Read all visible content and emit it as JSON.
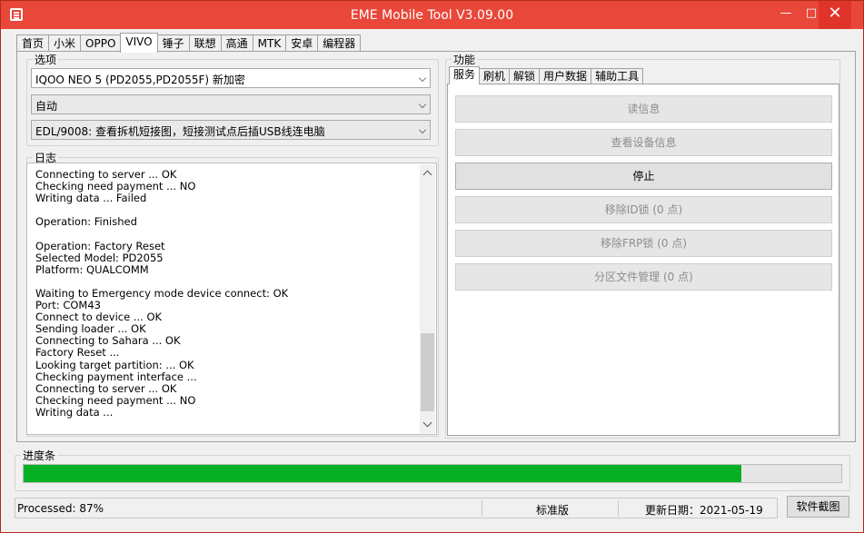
{
  "window": {
    "title": "EME Mobile Tool V3.09.00",
    "min_glyph": "—",
    "max_glyph": "□",
    "close_glyph": "✕"
  },
  "top_tabs": [
    "首页",
    "小米",
    "OPPO",
    "VIVO",
    "锤子",
    "联想",
    "高通",
    "MTK",
    "安卓",
    "编程器"
  ],
  "top_tab_active": "VIVO",
  "options": {
    "label": "选项",
    "model": "IQOO NEO 5 (PD2055,PD2055F) 新加密",
    "mode": "自动",
    "method": "EDL/9008: 查看拆机短接图，短接测试点后插USB线连电脑"
  },
  "log": {
    "label": "日志",
    "lines": [
      "Connecting to server ... OK",
      "Checking need payment ... NO",
      "Writing data ... Failed",
      "",
      "Operation: Finished",
      "",
      "Operation: Factory Reset",
      "Selected Model: PD2055",
      "Platform: QUALCOMM",
      "",
      "Waiting to Emergency mode device connect: OK",
      "Port: COM43",
      "Connect to device ... OK",
      "Sending loader ... OK",
      "Connecting to Sahara ... OK",
      "Factory Reset ...",
      "Looking target partition: ... OK",
      "Checking payment interface ...",
      "Connecting to server ... OK",
      "Checking need payment ... NO",
      "Writing data ..."
    ]
  },
  "functions": {
    "label": "功能",
    "tabs": [
      "服务",
      "刷机",
      "解锁",
      "用户数据",
      "辅助工具"
    ],
    "active_tab": "服务",
    "buttons": [
      {
        "label": "读信息",
        "enabled": false
      },
      {
        "label": "查看设备信息",
        "enabled": false
      },
      {
        "label": "停止",
        "enabled": true
      },
      {
        "label": "移除ID锁 (0 点)",
        "enabled": false
      },
      {
        "label": "移除FRP锁 (0 点)",
        "enabled": false
      },
      {
        "label": "分区文件管理 (0 点)",
        "enabled": false
      }
    ]
  },
  "progress": {
    "label": "进度条",
    "fraction": 0.878,
    "color": "#06b025"
  },
  "status": {
    "processed": "Processed: 87%",
    "edition": "标准版",
    "update_date": "更新日期：2021-05-19",
    "screenshot_button": "软件截图"
  }
}
